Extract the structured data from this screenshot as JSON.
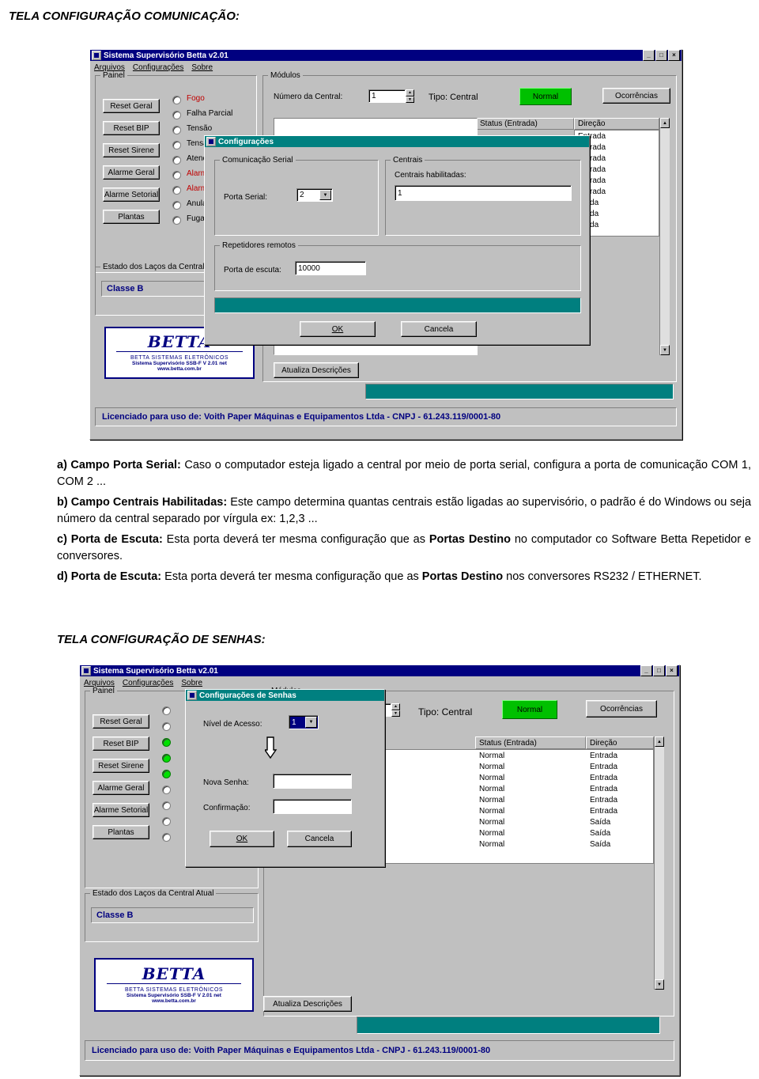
{
  "headings": {
    "comm": "TELA CONFIGURAÇÃO COMUNICAÇÃO:",
    "senhas": "TELA CONFlGURAÇÃO DE SENHAS:"
  },
  "app": {
    "title": "Sistema Supervisório Betta v2.01",
    "menu": [
      "Arquivos",
      "Configurações",
      "Sobre"
    ],
    "window_buttons": [
      "_",
      "□",
      "×"
    ],
    "panel_group": "Painel",
    "modules_group": "Módulos",
    "loops_group": "Estado dos Laços da Central Atual",
    "central_number_label": "Número da Central:",
    "central_number_value": "1",
    "type_label": "Tipo: Central",
    "normal_button": "Normal",
    "occurrences_button": "Ocorrências",
    "status_header": "Status (Entrada)",
    "direction_header": "Direção",
    "update_button": "Atualiza Descrições",
    "class_label": "Classe B",
    "license": "Licenciado para uso de: Voith Paper Máquinas e Equipamentos Ltda - CNPJ - 61.243.119/0001-80",
    "buttons": [
      "Reset Geral",
      "Reset BIP",
      "Reset Sirene",
      "Alarme Geral",
      "Alarme Setorial",
      "Plantas"
    ],
    "indicators": [
      "Fogo",
      "Falha Parcial",
      "Tensão",
      "Tensão",
      "Atendid",
      "Alarme",
      "Alarme",
      "Anulad",
      "FugaTe"
    ],
    "direction_values": [
      "Entrada",
      "Entrada",
      "Entrada",
      "Entrada",
      "Entrada",
      "Entrada",
      "Saída",
      "Saída",
      "Saída"
    ],
    "status_values": [
      "Normal",
      "Normal",
      "Normal",
      "Normal",
      "Normal",
      "Normal",
      "Normal",
      "Normal",
      "Normal"
    ],
    "logo": {
      "word": "BETTA",
      "sub": "BETTA SISTEMAS ELETRÔNICOS",
      "line1": "Sistema Supervisório SSB-F V 2.01 net",
      "line2": "www.betta.com.br"
    }
  },
  "dialog_comm": {
    "title": "Configurações",
    "serial_group": "Comunicação Serial",
    "serial_port_label": "Porta Serial:",
    "serial_port_value": "2",
    "centrals_group": "Centrais",
    "centrals_label": "Centrais habilitadas:",
    "centrals_value": "1",
    "repeaters_group": "Repetidores remotos",
    "listen_port_label": "Porta de escuta:",
    "listen_port_value": "10000",
    "ok": "OK",
    "cancel": "Cancela"
  },
  "dialog_senhas": {
    "title": "Configurações de Senhas",
    "level_label": "Nível de Acesso:",
    "level_value": "1",
    "new_password_label": "Nova Senha:",
    "new_password_value": "",
    "confirm_label": "Confirmação:",
    "confirm_value": "",
    "ok": "OK",
    "cancel": "Cancela"
  },
  "body_text": {
    "a": {
      "bold": "a) Campo Porta Serial:",
      "rest": " Caso o computador esteja ligado a central por meio de porta serial, configura a porta de comunicação COM 1, COM 2 ..."
    },
    "b": {
      "bold": "b) Campo Centrais Habilitadas:",
      "rest": " Este campo determina quantas centrais estão ligadas ao supervisório, o padrão é do Windows ou seja número da central separado por vírgula ex: 1,2,3 ..."
    },
    "c": {
      "bold": "c) Porta de Escuta:",
      "rest1": " Esta porta deverá ter mesma configuração que as ",
      "bold2": "Portas Destino",
      "rest2": " no computador co Software Betta Repetidor e conversores."
    },
    "d": {
      "bold": "d) Porta de Escuta:",
      "rest1": " Esta porta deverá ter mesma configuração que as ",
      "bold2": "Portas Destino",
      "rest2": " nos conversores RS232 / ETHERNET."
    }
  }
}
